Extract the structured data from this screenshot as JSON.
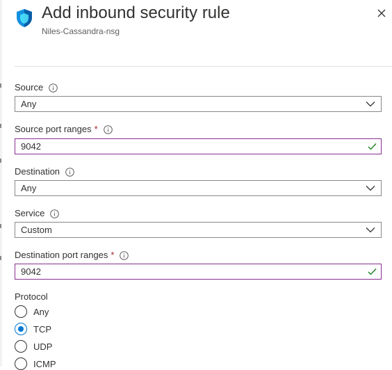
{
  "header": {
    "title": "Add inbound security rule",
    "subtitle": "Niles-Cassandra-nsg",
    "icon": "shield-icon",
    "close_icon": "close-icon"
  },
  "form": {
    "source": {
      "label": "Source",
      "value": "Any"
    },
    "source_port_ranges": {
      "label": "Source port ranges",
      "required_marker": "*",
      "value": "9042"
    },
    "destination": {
      "label": "Destination",
      "value": "Any"
    },
    "service": {
      "label": "Service",
      "value": "Custom"
    },
    "destination_port_ranges": {
      "label": "Destination port ranges",
      "required_marker": "*",
      "value": "9042"
    },
    "protocol": {
      "label": "Protocol",
      "options": [
        "Any",
        "TCP",
        "UDP",
        "ICMP"
      ],
      "selected": "TCP"
    }
  },
  "colors": {
    "accent": "#0078d4",
    "valid_check": "#107c10",
    "input_border_active": "#8a2d8f",
    "required": "#a4262c"
  }
}
